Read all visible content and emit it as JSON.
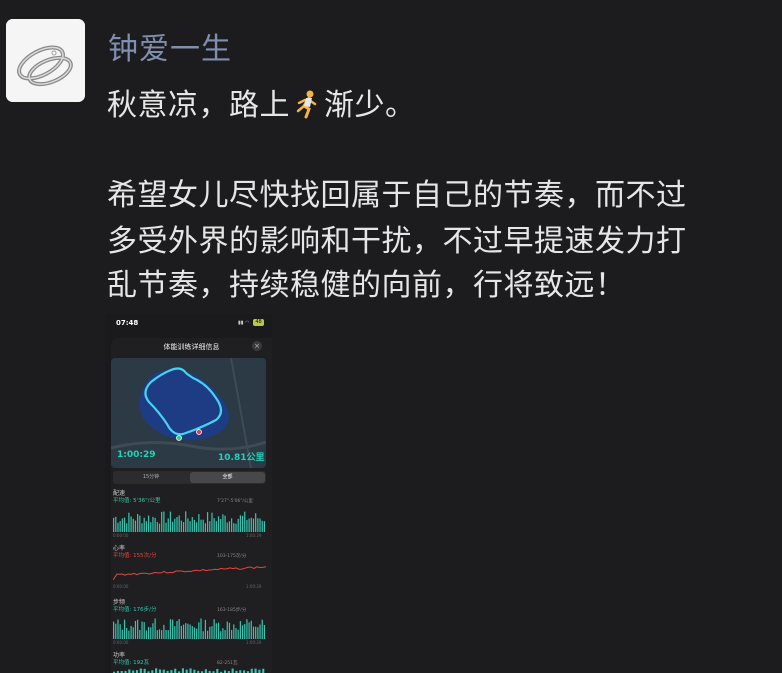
{
  "sender": {
    "name": "钟爱一生"
  },
  "message": {
    "line1_before": "秋意凉，路上",
    "line1_emoji": "runner-emoji",
    "line1_after": "渐少。",
    "para2": [
      "希望女儿尽快找回属于自己的节奏，而不过",
      "多受外界的影响和干扰，不过早提速发力打",
      "乱节奏，持续稳健的向前，行将致远！"
    ]
  },
  "screenshot": {
    "status_time": "07:48",
    "battery": "48",
    "title": "体能训练详细信息",
    "close": "×",
    "map_time": "1:00:29",
    "map_distance": "10.81公里",
    "segment_left": "15分钟",
    "segment_right": "全部",
    "sections": [
      {
        "title": "配速",
        "avg": "平均值: 5'36\"/公里",
        "range": "7'27\"-5'06\"/公里",
        "t_start": "0:00:00",
        "t_end": "1:00:29",
        "color": "#35c7b1"
      },
      {
        "title": "心率",
        "avg": "平均值: 155次/分",
        "range": "103-175次/分",
        "t_start": "0:00:00",
        "t_end": "1:00:29",
        "color": "#e8463c"
      },
      {
        "title": "步频",
        "avg": "平均值: 176步/分",
        "range": "163-185步/分",
        "t_start": "0:00:00",
        "t_end": "1:00:29",
        "color": "#35c7b1"
      },
      {
        "title": "功率",
        "avg": "平均值: 192瓦",
        "range": "82-251瓦",
        "t_start": "",
        "t_end": "",
        "color": "#35c7b1"
      }
    ]
  },
  "colors": {
    "background": "#1c1c1e",
    "name": "#7f8fae",
    "text": "#e6e6e6",
    "accent": "#1fd3b8"
  }
}
